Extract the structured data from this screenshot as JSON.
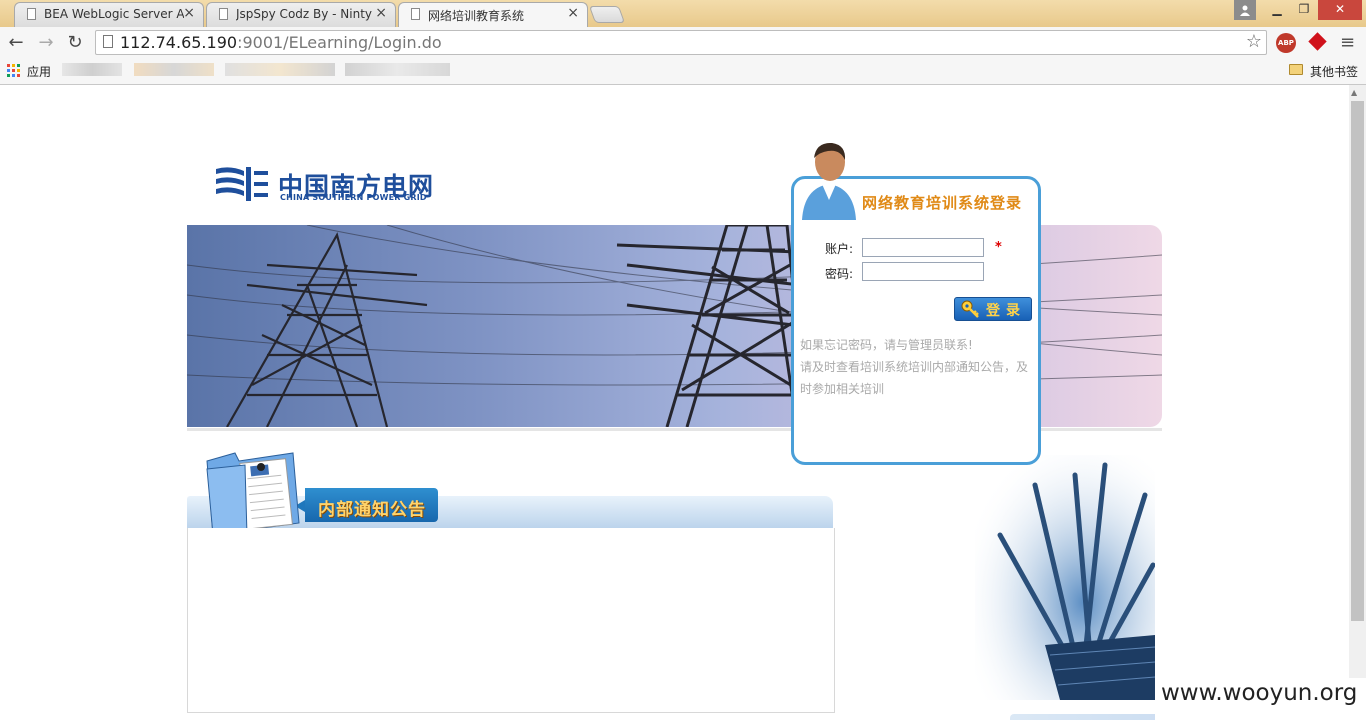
{
  "browser": {
    "tabs": [
      {
        "title": "BEA WebLogic Server Ad",
        "active": false
      },
      {
        "title": "JspSpy Codz By - Ninty",
        "active": false
      },
      {
        "title": "网络培训教育系统",
        "active": true
      }
    ],
    "url": {
      "host": "112.74.65.190",
      "rest": ":9001/ELearning/Login.do"
    },
    "apps_label": "应用",
    "other_bookmarks": "其他书签",
    "abp_label": "ABP"
  },
  "page": {
    "logo": {
      "cn": "中国南方电网",
      "en": "CHINA SOUTHERN POWER GRID"
    },
    "notice_title": "内部通知公告",
    "login": {
      "title": "网络教育培训系统登录",
      "username_label": "账户:",
      "password_label": "密码:",
      "username_value": "",
      "password_value": "",
      "required_mark": "*",
      "submit_label": "登录",
      "tip1": "如果忘记密码，请与管理员联系!",
      "tip2": "请及时查看培训系统培训内部通知公告，及",
      "tip3": "时参加相关培训"
    },
    "watermark": "www.wooyun.org"
  },
  "colors": {
    "brand_blue": "#1f4f9c",
    "login_border": "#4a9fd8",
    "title_orange": "#e08a17",
    "tab_strip": "#e8c98b"
  }
}
